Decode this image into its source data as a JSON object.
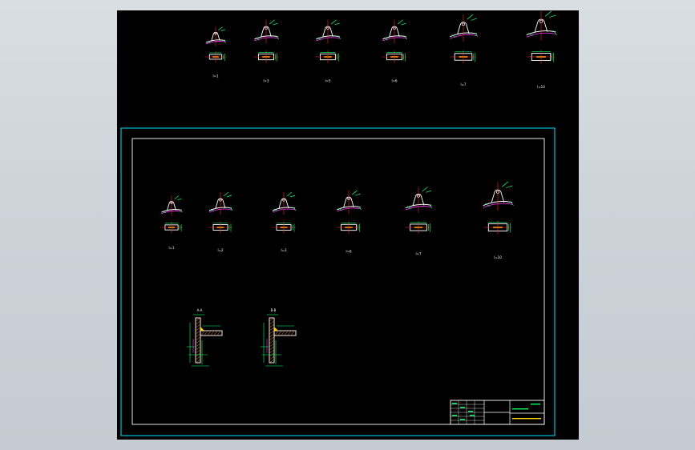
{
  "viewer": {
    "background": "#000000",
    "frame_color": "#00e5ff",
    "part_color": "#ffffff",
    "dimension_color": "#00ff66",
    "centerline_color": "#ff2020",
    "accent_color": "#ff33ff",
    "weld_color": "#ffd000",
    "hatch_color": "#ff8800"
  },
  "top_row": {
    "labels": [
      "l=1",
      "l=3",
      "l=5",
      "l=6",
      "l=7",
      "l=10"
    ]
  },
  "sheet": {
    "row_labels": [
      "l=1",
      "l=2",
      "l=3",
      "l=6",
      "l=7",
      "l=10"
    ],
    "sections": [
      {
        "label": "A-A"
      },
      {
        "label": "B-B"
      }
    ],
    "title_block": {
      "drawing_no": "",
      "scale": "",
      "sheet": ""
    }
  }
}
